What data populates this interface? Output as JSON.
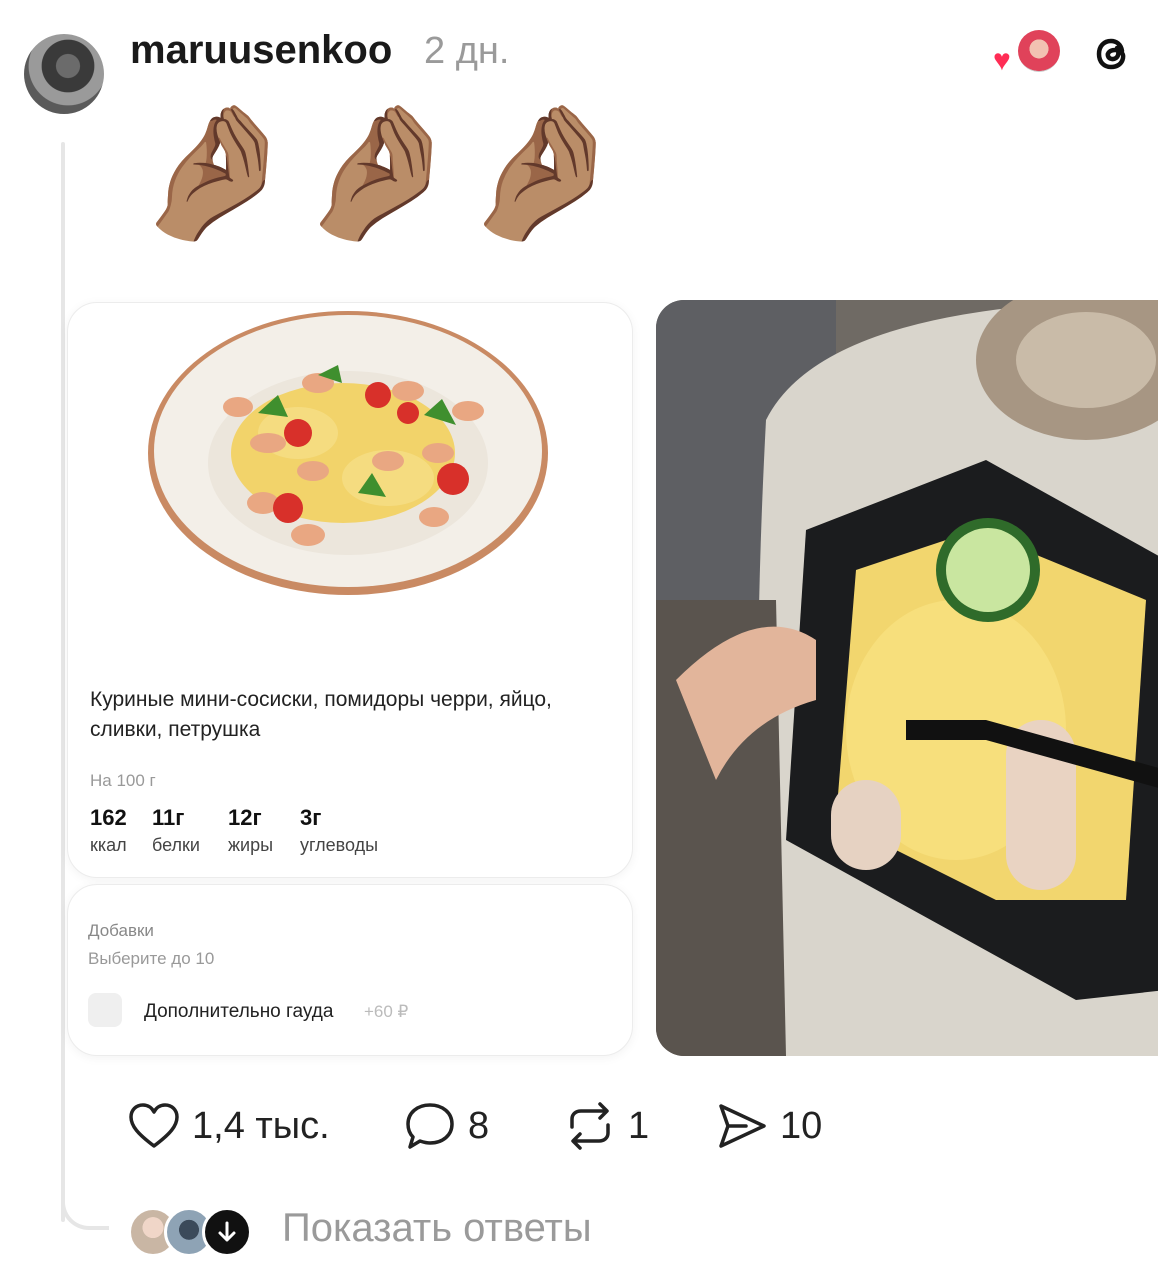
{
  "post": {
    "username": "maruusenkoo",
    "time": "2 дн.",
    "emojis": [
      "🤌🏽",
      "🤌🏽",
      "🤌🏽"
    ]
  },
  "card": {
    "description": "Куриные мини-сосиски, помидоры черри, яйцо, сливки, петрушка",
    "per_label": "На 100 г",
    "nutrition": [
      {
        "value": "162",
        "label": "ккал"
      },
      {
        "value": "11г",
        "label": "белки"
      },
      {
        "value": "12г",
        "label": "жиры"
      },
      {
        "value": "3г",
        "label": "углеводы"
      }
    ],
    "addons_title": "Добавки",
    "addons_subtitle": "Выберите до 10",
    "addon_label": "Дополнительно гауда",
    "addon_price": "+60 ₽"
  },
  "actions": {
    "likes": "1,4 тыс.",
    "comments": "8",
    "reposts": "1",
    "shares": "10"
  },
  "footer": {
    "show_replies": "Показать ответы"
  },
  "colors": {
    "heart": "#ff2d55",
    "muted": "#9a9a9a"
  }
}
